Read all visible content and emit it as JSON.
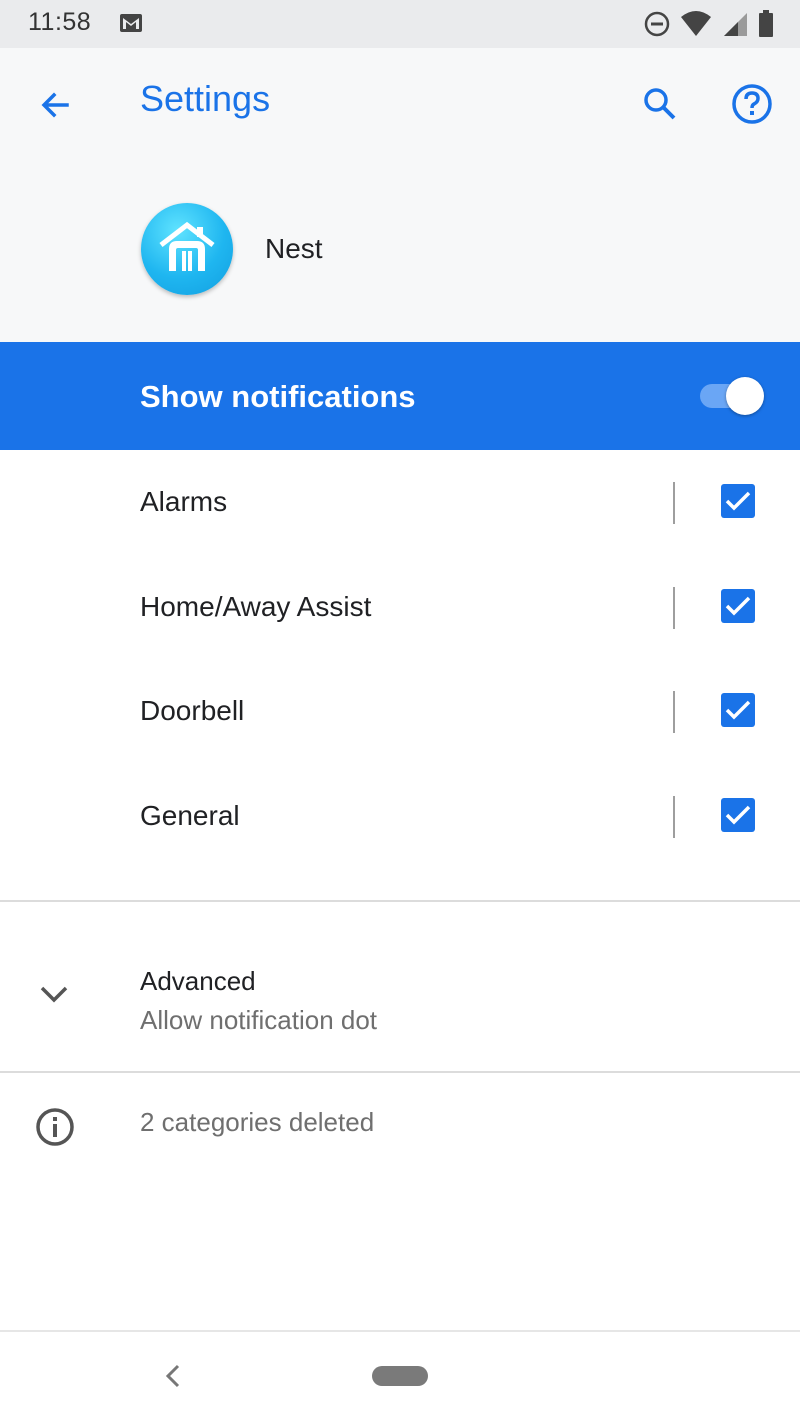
{
  "status_bar": {
    "time": "11:58",
    "icons": [
      "gmail-icon",
      "do-not-disturb-icon",
      "wifi-icon",
      "signal-icon",
      "battery-icon"
    ]
  },
  "header": {
    "title": "Settings",
    "back_icon": "arrow-left-icon",
    "search_icon": "search-icon",
    "help_icon": "help-icon"
  },
  "app": {
    "name": "Nest",
    "icon": "nest-home-icon"
  },
  "show_notifications": {
    "label": "Show notifications",
    "enabled": true
  },
  "categories": [
    {
      "label": "Alarms",
      "checked": true
    },
    {
      "label": "Home/Away Assist",
      "checked": true
    },
    {
      "label": "Doorbell",
      "checked": true
    },
    {
      "label": "General",
      "checked": true
    }
  ],
  "advanced": {
    "title": "Advanced",
    "subtitle": "Allow notification dot"
  },
  "info": {
    "text": "2 categories deleted"
  },
  "colors": {
    "accent": "#1a73e8",
    "header_bg": "#f7f8f9",
    "status_bar_bg": "#eaebed"
  }
}
